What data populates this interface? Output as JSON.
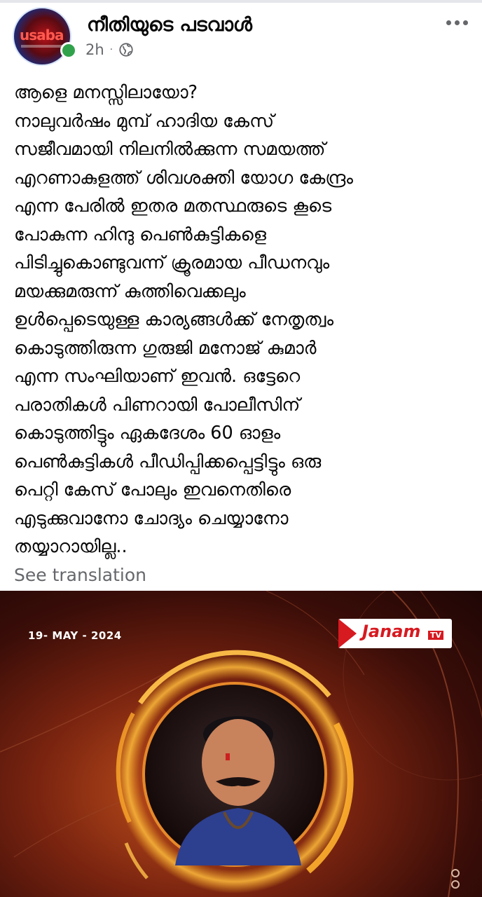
{
  "post": {
    "page_name": "നീതിയുടെ പടവാൾ",
    "timestamp": "2h",
    "separator": "·",
    "privacy_icon": "globe-icon",
    "more_icon": "more-horizontal-icon",
    "avatar_text": "usaba",
    "body_lines": [
      "ആളെ മനസ്സിലായോ?",
      "നാലുവർഷം മുമ്പ് ഹാദിയ കേസ്",
      "സജീവമായി നിലനിൽക്കുന്ന സമയത്ത്",
      "എറണാകുളത്ത് ശിവശക്തി യോഗ കേന്ദ്രം",
      "എന്ന പേരിൽ ഇതര മതസ്ഥരുടെ കൂടെ",
      "പോകുന്ന ഹിന്ദു പെൺകുട്ടികളെ",
      "പിടിച്ചുകൊണ്ടുവന്ന് ക്രൂരമായ പീഡനവും",
      "മയക്കുമരുന്ന് കുത്തിവെക്കലും",
      "ഉൾപ്പെടെയുള്ള കാര്യങ്ങൾക്ക് നേതൃത്വം",
      "കൊടുത്തിരുന്ന ഗുരുജി മനോജ് കുമാർ",
      "എന്ന സംഘിയാണ് ഇവൻ. ഒട്ടേറെ",
      "പരാതികൾ പിണറായി പോലീസിന്",
      "കൊടുത്തിട്ടും ഏകദേശം 60 ഓളം",
      "പെൺകുട്ടികൾ പീഡിപ്പിക്കപ്പെട്ടിട്ടും ഒരു",
      "പെറ്റി കേസ് പോലും ഇവനെതിരെ",
      "എടുക്കുവാനോ ചോദ്യം ചെയ്യാനോ",
      "തയ്യാറായില്ല.."
    ],
    "see_translation": "See translation"
  },
  "media": {
    "date": "19- MAY - 2024",
    "brand_name": "Janam",
    "brand_suffix": "TV",
    "colors": {
      "ring": "#f5a623",
      "background_dark": "#1e0605",
      "background_glow": "#c5531c",
      "brand_red": "#d71920"
    }
  },
  "colors": {
    "online_dot": "#31a24c",
    "secondary_text": "#65676b"
  }
}
